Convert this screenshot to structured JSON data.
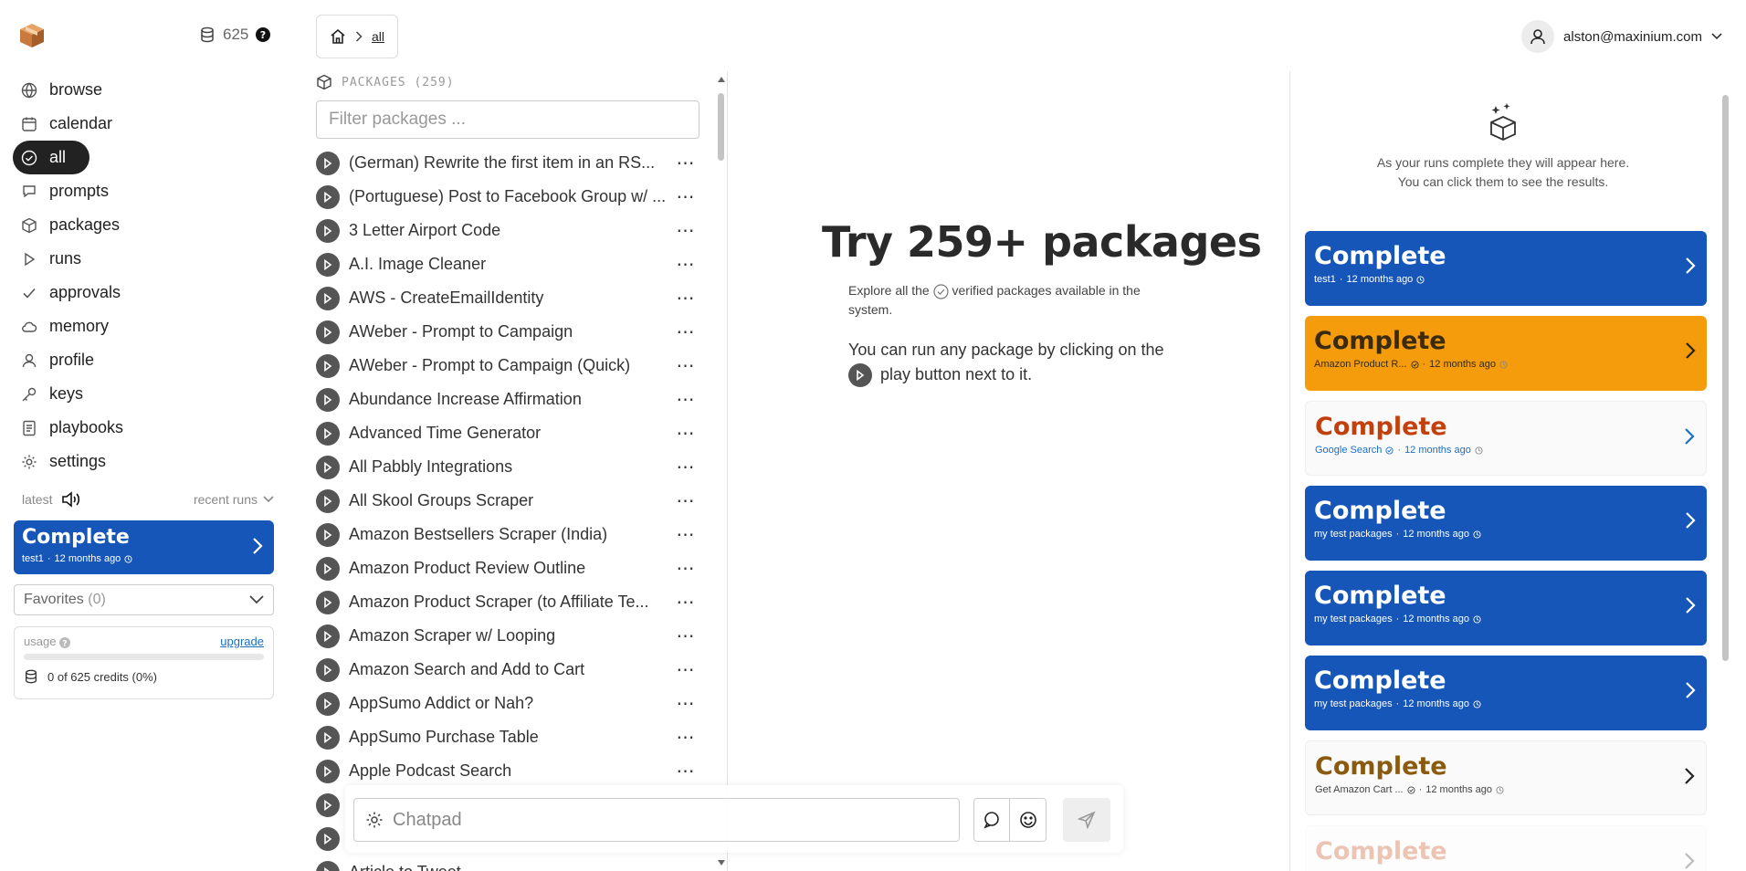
{
  "sidebar": {
    "credits": "625",
    "nav": [
      {
        "label": "browse",
        "icon": "globe-icon"
      },
      {
        "label": "calendar",
        "icon": "calendar-icon"
      },
      {
        "label": "all",
        "icon": "check-circle-icon",
        "active": true
      },
      {
        "label": "prompts",
        "icon": "chat-bubble-icon"
      },
      {
        "label": "packages",
        "icon": "cube-icon"
      },
      {
        "label": "runs",
        "icon": "play-icon"
      },
      {
        "label": "approvals",
        "icon": "checkmark-icon"
      },
      {
        "label": "memory",
        "icon": "cloud-icon"
      },
      {
        "label": "profile",
        "icon": "person-icon"
      },
      {
        "label": "keys",
        "icon": "key-icon"
      },
      {
        "label": "playbooks",
        "icon": "document-icon"
      },
      {
        "label": "settings",
        "icon": "gear-icon"
      }
    ],
    "latest_label": "latest",
    "recent_runs_label": "recent runs",
    "latest_run": {
      "status": "Complete",
      "name": "test1",
      "time": "12 months ago",
      "color": "#1656b8"
    },
    "favorites_label": "Favorites",
    "favorites_count": "(0)",
    "usage": {
      "label": "usage",
      "upgrade": "upgrade",
      "credits_text": "0 of 625 credits",
      "percent_text": "(0%)",
      "percent": 0
    }
  },
  "breadcrumb": {
    "current": "all"
  },
  "user": {
    "email": "alston@maxinium.com"
  },
  "packages": {
    "header": "PACKAGES (259)",
    "filter_placeholder": "Filter packages ...",
    "items": [
      "(German) Rewrite the first item in an RS...",
      "(Portuguese) Post to Facebook Group w/ ...",
      "3 Letter Airport Code",
      "A.I. Image Cleaner",
      "AWS - CreateEmailIdentity",
      "AWeber - Prompt to Campaign",
      "AWeber - Prompt to Campaign (Quick)",
      "Abundance Increase Affirmation",
      "Advanced Time Generator",
      "All Pabbly Integrations",
      "All Skool Groups Scraper",
      "Amazon Bestsellers Scraper (India)",
      "Amazon Product Review Outline",
      "Amazon Product Scraper (to Affiliate Te...",
      "Amazon Scraper w/ Looping",
      "Amazon Search and Add to Cart",
      "AppSumo Addict or Nah?",
      "AppSumo Purchase Table",
      "Apple Podcast Search",
      "",
      "",
      "Article to Tweet"
    ]
  },
  "center": {
    "title": "Try 259+ packages",
    "explore_pre": "Explore all the",
    "explore_post": "verified packages available in the system.",
    "run_pre": "You can run any package by clicking on the",
    "run_post": "play button next to it."
  },
  "runs": {
    "empty_line1": "As your runs complete they will appear here.",
    "empty_line2": "You can click them to see the results.",
    "items": [
      {
        "status": "Complete",
        "name": "test1",
        "time": "12 months ago",
        "style": "blue",
        "verified": false
      },
      {
        "status": "Complete",
        "name": "Amazon Product R...",
        "time": "12 months ago",
        "style": "orange",
        "verified": true
      },
      {
        "status": "Complete",
        "name": "Google Search",
        "time": "12 months ago",
        "style": "white-red",
        "verified": true
      },
      {
        "status": "Complete",
        "name": "my test packages",
        "time": "12 months ago",
        "style": "blue",
        "verified": false
      },
      {
        "status": "Complete",
        "name": "my test packages",
        "time": "12 months ago",
        "style": "blue",
        "verified": false
      },
      {
        "status": "Complete",
        "name": "my test packages",
        "time": "12 months ago",
        "style": "blue",
        "verified": false
      },
      {
        "status": "Complete",
        "name": "Get Amazon Cart ...",
        "time": "12 months ago",
        "style": "white-brown",
        "verified": true
      },
      {
        "status": "Complete",
        "name": "",
        "time": "",
        "style": "faded",
        "verified": false
      }
    ]
  },
  "chatpad": {
    "placeholder": "Chatpad"
  },
  "colors": {
    "primary_blue": "#1656b8",
    "orange": "#f59c0c",
    "dark": "#222222",
    "link": "#1a6fc4"
  }
}
